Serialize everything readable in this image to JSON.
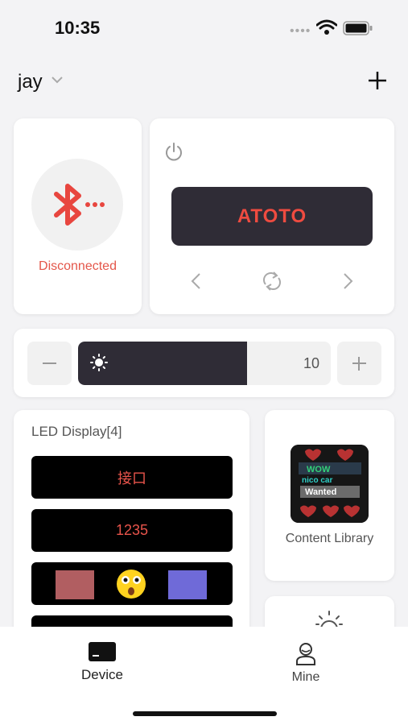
{
  "status_bar": {
    "time": "10:35"
  },
  "header": {
    "user_name": "jay",
    "add_icon": "plus-icon"
  },
  "connection": {
    "status": "Disconnected",
    "icon": "bluetooth-icon",
    "color": "#e4564a"
  },
  "control": {
    "display_text": "ATOTO",
    "power_icon": "power-icon",
    "prev_icon": "chevron-left-icon",
    "loop_icon": "loop-icon",
    "next_icon": "chevron-right-icon"
  },
  "brightness": {
    "value": "10",
    "level_fraction": 0.67,
    "icon": "sun-icon"
  },
  "led_display": {
    "title": "LED Display[4]",
    "items": [
      {
        "text": "接口"
      },
      {
        "text": "1235"
      },
      {
        "text": ""
      },
      {
        "text": ""
      }
    ]
  },
  "content_library": {
    "label": "Content Library",
    "thumbnail_text": [
      "WOW",
      "nico car",
      "Wanted"
    ]
  },
  "tabs": [
    {
      "label": "Device",
      "icon": "device-icon",
      "active": true
    },
    {
      "label": "Mine",
      "icon": "profile-icon",
      "active": false
    }
  ],
  "colors": {
    "accent": "#e4564a",
    "dark": "#2f2c36",
    "background": "#f3f3f5"
  }
}
